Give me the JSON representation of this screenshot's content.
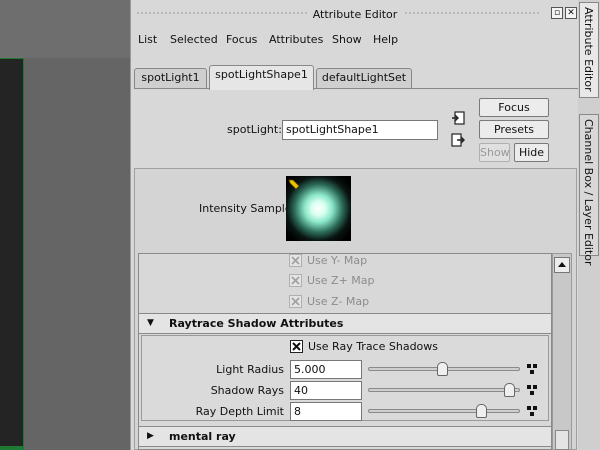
{
  "window": {
    "title": "Attribute Editor"
  },
  "menu": [
    "List",
    "Selected",
    "Focus",
    "Attributes",
    "Show",
    "Help"
  ],
  "tabs": [
    "spotLight1",
    "spotLightShape1",
    "defaultLightSet"
  ],
  "node": {
    "label": "spotLight:",
    "value": "spotLightShape1"
  },
  "buttons": {
    "focus": "Focus",
    "presets": "Presets",
    "show": "Show",
    "hide": "Hide"
  },
  "intensity_sample": {
    "label": "Intensity Sample"
  },
  "map_options": [
    {
      "label": "Use Y- Map",
      "checked": true,
      "enabled": false
    },
    {
      "label": "Use Z+ Map",
      "checked": true,
      "enabled": false
    },
    {
      "label": "Use Z- Map",
      "checked": true,
      "enabled": false
    }
  ],
  "sections": {
    "raytrace": {
      "title": "Raytrace Shadow Attributes",
      "expanded": true,
      "use_ray_trace": {
        "label": "Use Ray Trace Shadows",
        "checked": true
      },
      "attributes": [
        {
          "label": "Light Radius",
          "value": "5.000",
          "slider": 0.49
        },
        {
          "label": "Shadow Rays",
          "value": "40",
          "slider": 0.97
        },
        {
          "label": "Ray Depth Limit",
          "value": "8",
          "slider": 0.77
        }
      ]
    },
    "mental_ray": {
      "title": "mental ray",
      "expanded": false
    }
  },
  "side_tabs": [
    "Attribute Editor",
    "Channel Box / Layer Editor"
  ],
  "colors": {
    "panel_bg": "#d8d8d8",
    "viewport_dark": "#151515",
    "selection_green": "#1e7a33"
  }
}
